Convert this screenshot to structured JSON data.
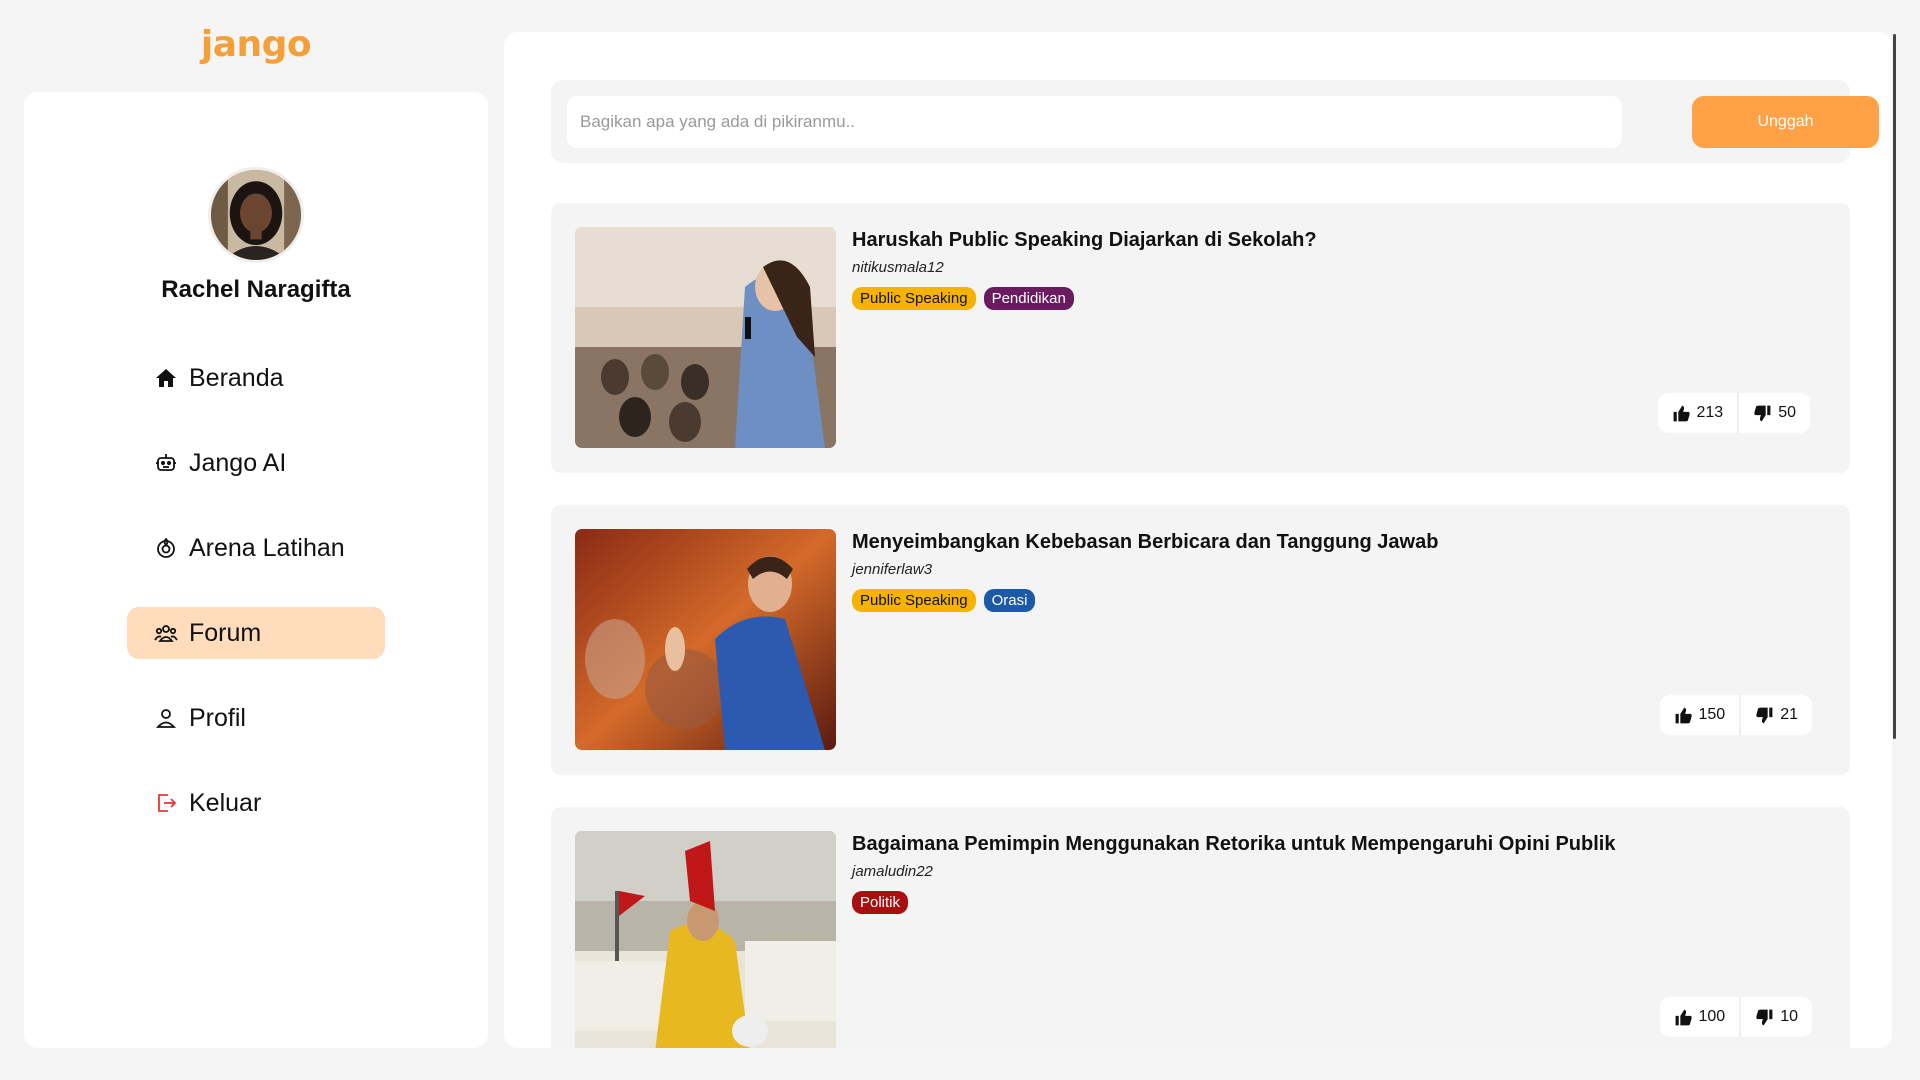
{
  "brand": {
    "logo_text": "jango",
    "color": "#f59f3b"
  },
  "user": {
    "name": "Rachel Naragifta"
  },
  "nav": [
    {
      "label": "Beranda",
      "icon": "home-icon",
      "active": false
    },
    {
      "label": "Jango AI",
      "icon": "robot-icon",
      "active": false
    },
    {
      "label": "Arena Latihan",
      "icon": "target-icon",
      "active": false
    },
    {
      "label": "Forum",
      "icon": "users-icon",
      "active": true
    },
    {
      "label": "Profil",
      "icon": "user-icon",
      "active": false
    },
    {
      "label": "Keluar",
      "icon": "logout-icon",
      "active": false
    }
  ],
  "composer": {
    "placeholder": "Bagikan apa yang ada di pikiranmu..",
    "value": "",
    "submit_label": "Unggah"
  },
  "posts": [
    {
      "title": "Haruskah Public Speaking Diajarkan di Sekolah?",
      "author": "nitikusmala12",
      "tags": [
        {
          "label": "Public Speaking",
          "color": "#f5b300",
          "text_color": "#111"
        },
        {
          "label": "Pendidikan",
          "color": "#6a1a5e",
          "text_color": "#fff"
        }
      ],
      "likes": "213",
      "dislikes": "50"
    },
    {
      "title": "Menyeimbangkan Kebebasan Berbicara dan Tanggung Jawab",
      "author": "jenniferlaw3",
      "tags": [
        {
          "label": "Public Speaking",
          "color": "#f5b300",
          "text_color": "#111"
        },
        {
          "label": "Orasi",
          "color": "#1c5aa5",
          "text_color": "#fff"
        }
      ],
      "likes": "150",
      "dislikes": "21"
    },
    {
      "title": "Bagaimana Pemimpin Menggunakan Retorika untuk Mempengaruhi Opini Publik",
      "author": "jamaludin22",
      "tags": [
        {
          "label": "Politik",
          "color": "#a80f0f",
          "text_color": "#fff"
        }
      ],
      "likes": "100",
      "dislikes": "10"
    }
  ]
}
